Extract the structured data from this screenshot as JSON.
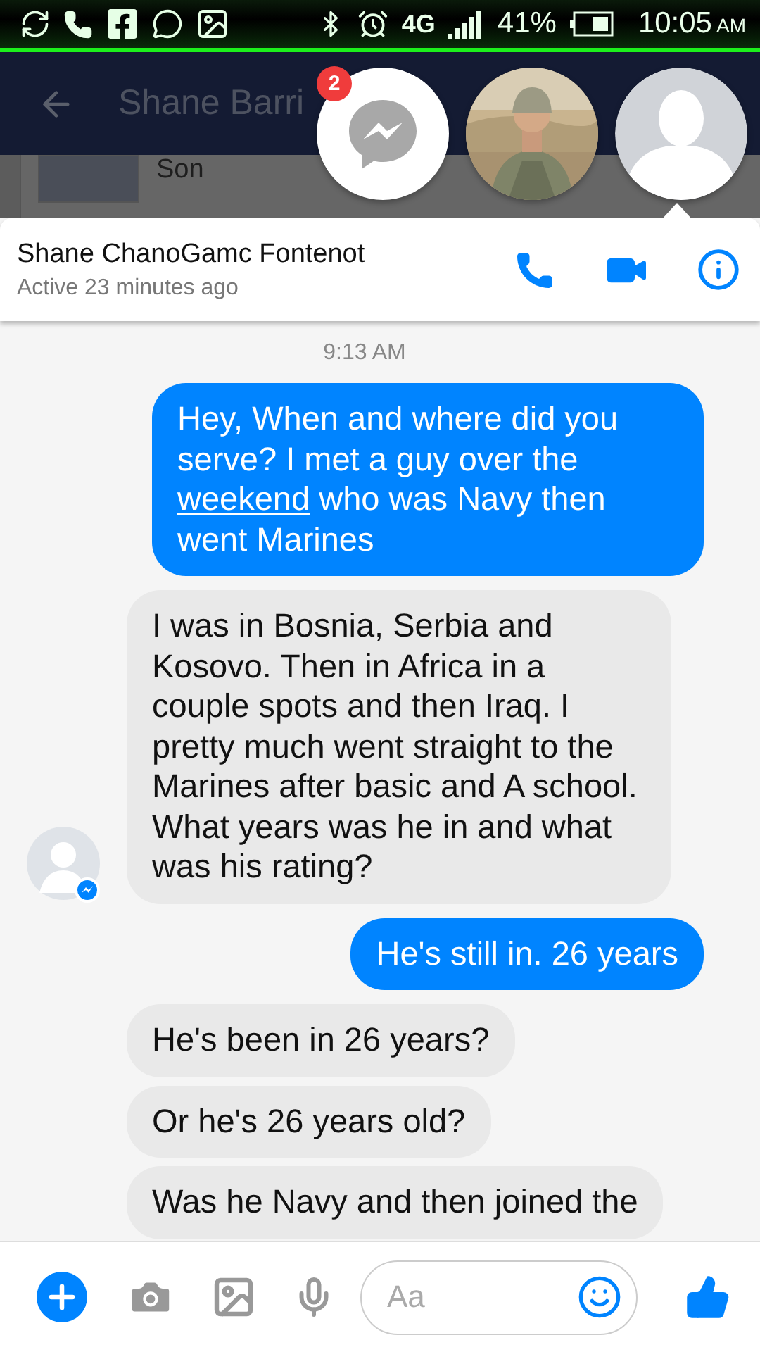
{
  "status_bar": {
    "network": "4G",
    "battery": "41%",
    "time": "10:05",
    "meridiem": "AM"
  },
  "app_bar": {
    "title": "Shane Barri"
  },
  "background_item": {
    "label": "Son"
  },
  "chat_heads": {
    "badge": "2"
  },
  "conversation": {
    "name": "Shane ChanoGamc Fontenot",
    "status": "Active 23 minutes ago"
  },
  "messages": [
    {
      "kind": "timestamp",
      "text": "9:13 AM"
    },
    {
      "kind": "outgoing",
      "parts": [
        {
          "text": "Hey, When and where did you serve? I met a guy over the ",
          "link": false
        },
        {
          "text": "weekend",
          "link": true
        },
        {
          "text": " who was Navy then went Marines",
          "link": false
        }
      ]
    },
    {
      "kind": "incoming",
      "avatar": true,
      "parts": [
        {
          "text": "I was in Bosnia, Serbia and Kosovo. Then in Africa in a couple spots and then Iraq. I pretty much went straight to the Marines after basic and A school. What years was he in and what was his rating?",
          "link": false
        }
      ]
    },
    {
      "kind": "outgoing",
      "parts": [
        {
          "text": "He's still in. 26 years",
          "link": false
        }
      ]
    },
    {
      "kind": "incoming",
      "avatar": false,
      "parts": [
        {
          "text": "He's been in 26 years?",
          "link": false
        }
      ]
    },
    {
      "kind": "incoming",
      "avatar": false,
      "parts": [
        {
          "text": "Or he's 26 years old?",
          "link": false
        }
      ]
    },
    {
      "kind": "incoming",
      "avatar": false,
      "parts": [
        {
          "text": "Was he Navy and then joined the",
          "link": false
        }
      ]
    }
  ],
  "composer": {
    "placeholder": "Aa"
  }
}
